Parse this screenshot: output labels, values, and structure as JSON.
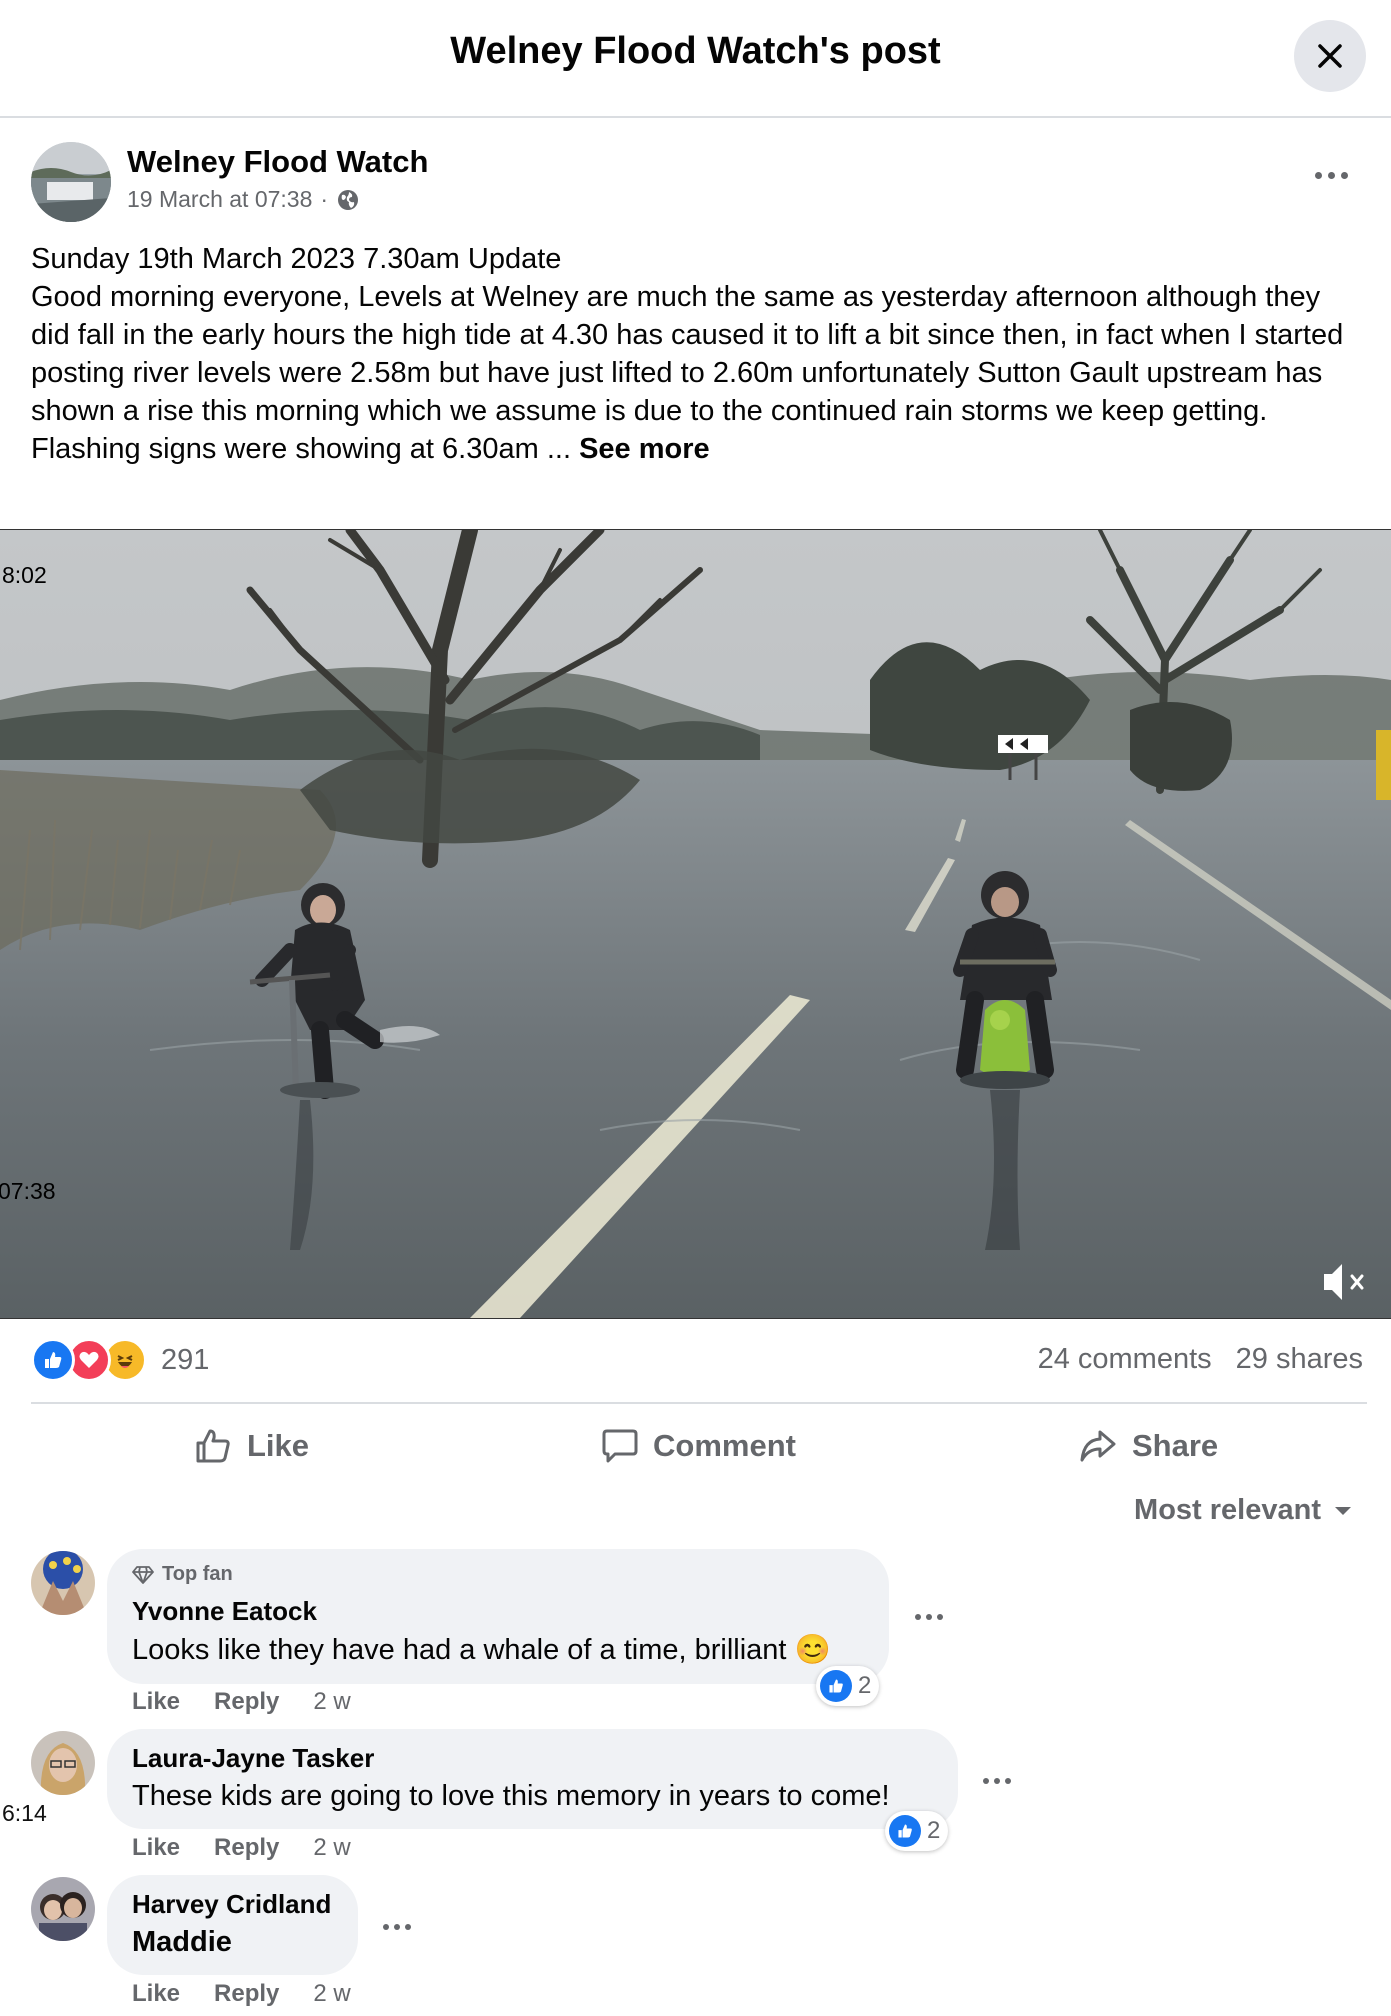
{
  "header": {
    "title": "Welney Flood Watch's post"
  },
  "post": {
    "page_name": "Welney Flood Watch",
    "date": "19 March at 07:38",
    "separator": "·",
    "text_lines": [
      "Sunday 19th March 2023 7.30am Update",
      "Good morning everyone, Levels at Welney are much the same as yesterday afternoon although they did fall in the early hours the high tide at 4.30 has caused it to lift a bit since then, in fact when I started posting river levels were 2.58m but have just lifted to 2.60m unfortunately Sutton Gault upstream has shown a rise this morning which we assume is due to the continued rain storms we keep getting."
    ],
    "last_line": "Flashing signs were showing at 6.30am ...",
    "see_more": "See more"
  },
  "video": {
    "timestamp_top": "8:02",
    "timestamp_bottom": "07:38",
    "muted": true
  },
  "engagement": {
    "reaction_icons": [
      "like-icon",
      "love-icon",
      "haha-icon"
    ],
    "reaction_count": "291",
    "comments": "24 comments",
    "shares": "29 shares"
  },
  "actions": {
    "like": "Like",
    "comment": "Comment",
    "share": "Share"
  },
  "sort": {
    "label": "Most relevant"
  },
  "comments": [
    {
      "badge": "Top fan",
      "name": "Yvonne Eatock",
      "text": "Looks like they have had a whale of a time, brilliant",
      "emoji": "😊",
      "likes": "2",
      "like": "Like",
      "reply": "Reply",
      "time": "2 w"
    },
    {
      "name": "Laura-Jayne Tasker",
      "text": "These kids are going to love this memory in years to come!",
      "likes": "2",
      "like": "Like",
      "reply": "Reply",
      "time": "2 w",
      "side_timestamp": "6:14"
    },
    {
      "name": "Harvey Cridland",
      "text": "Maddie",
      "like": "Like",
      "reply": "Reply",
      "time": "2 w"
    }
  ],
  "colors": {
    "brand_blue": "#1877f2",
    "love_red": "#f33e58",
    "haha_yellow": "#f7b928",
    "muted_text": "#65676b"
  }
}
